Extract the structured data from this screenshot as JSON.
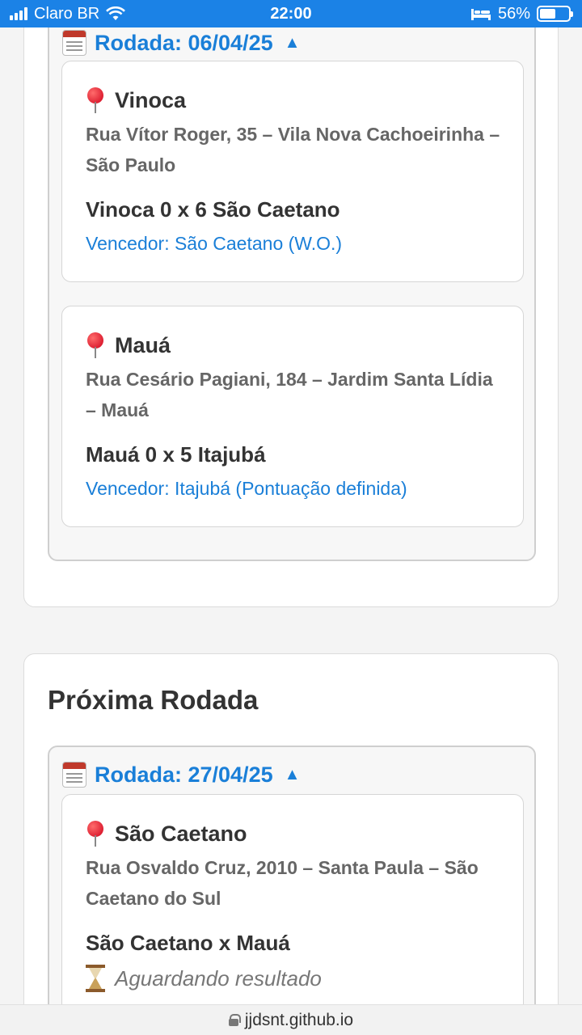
{
  "status_bar": {
    "carrier": "Claro BR",
    "time": "22:00",
    "battery": "56%",
    "battery_level": 0.56
  },
  "previous_round": {
    "header": "Rodada: 06/04/25",
    "toggle_icon": "▲",
    "matches": [
      {
        "venue": "Vinoca",
        "address": "Rua Vítor Roger, 35 – Vila Nova Cachoeirinha – São Paulo",
        "score": "Vinoca 0 x 6 São Caetano",
        "result": "Vencedor: São Caetano (W.O.)"
      },
      {
        "venue": "Mauá",
        "address": "Rua Cesário Pagiani, 184 – Jardim Santa Lídia – Mauá",
        "score": "Mauá 0 x 5 Itajubá",
        "result": "Vencedor: Itajubá (Pontuação definida)"
      }
    ]
  },
  "next_round": {
    "title": "Próxima Rodada",
    "header": "Rodada: 27/04/25",
    "toggle_icon": "▲",
    "matches": [
      {
        "venue": "São Caetano",
        "address": "Rua Osvaldo Cruz, 2010 – Santa Paula – São Caetano do Sul",
        "score": "São Caetano x Mauá",
        "status": "Aguardando resultado"
      }
    ]
  },
  "url_bar": {
    "domain": "jjdsnt.github.io"
  }
}
